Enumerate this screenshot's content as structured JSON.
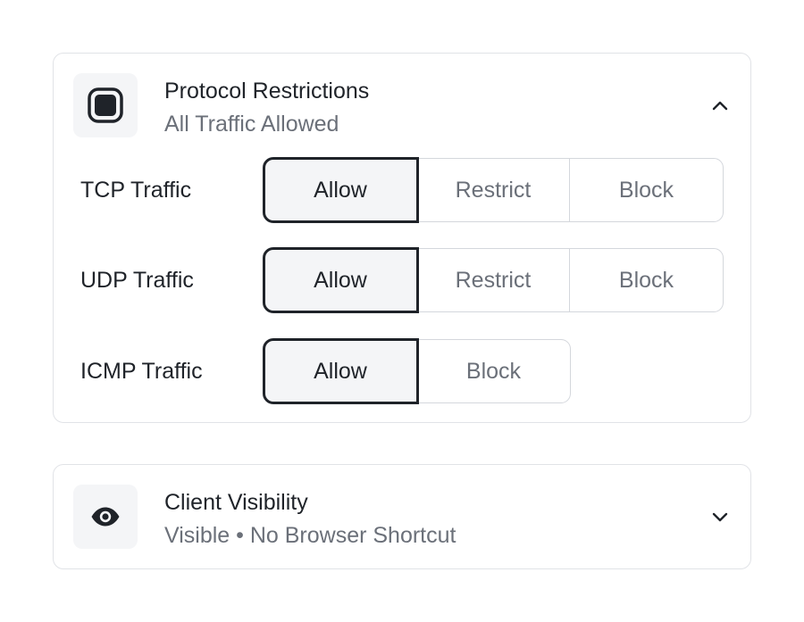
{
  "protocol_section": {
    "title": "Protocol Restrictions",
    "subtitle": "All Traffic Allowed",
    "icon": "stop-square-icon",
    "expanded": true,
    "rows": [
      {
        "label": "TCP Traffic",
        "options": [
          "Allow",
          "Restrict",
          "Block"
        ],
        "selected": "Allow"
      },
      {
        "label": "UDP Traffic",
        "options": [
          "Allow",
          "Restrict",
          "Block"
        ],
        "selected": "Allow"
      },
      {
        "label": "ICMP Traffic",
        "options": [
          "Allow",
          "Block"
        ],
        "selected": "Allow"
      }
    ]
  },
  "visibility_section": {
    "title": "Client Visibility",
    "subtitle": "Visible • No Browser Shortcut",
    "icon": "eye-icon",
    "expanded": false
  },
  "colors": {
    "text_primary": "#1f2329",
    "text_secondary": "#6b7079",
    "border": "#e1e3e7",
    "tile_bg": "#f4f5f7"
  }
}
